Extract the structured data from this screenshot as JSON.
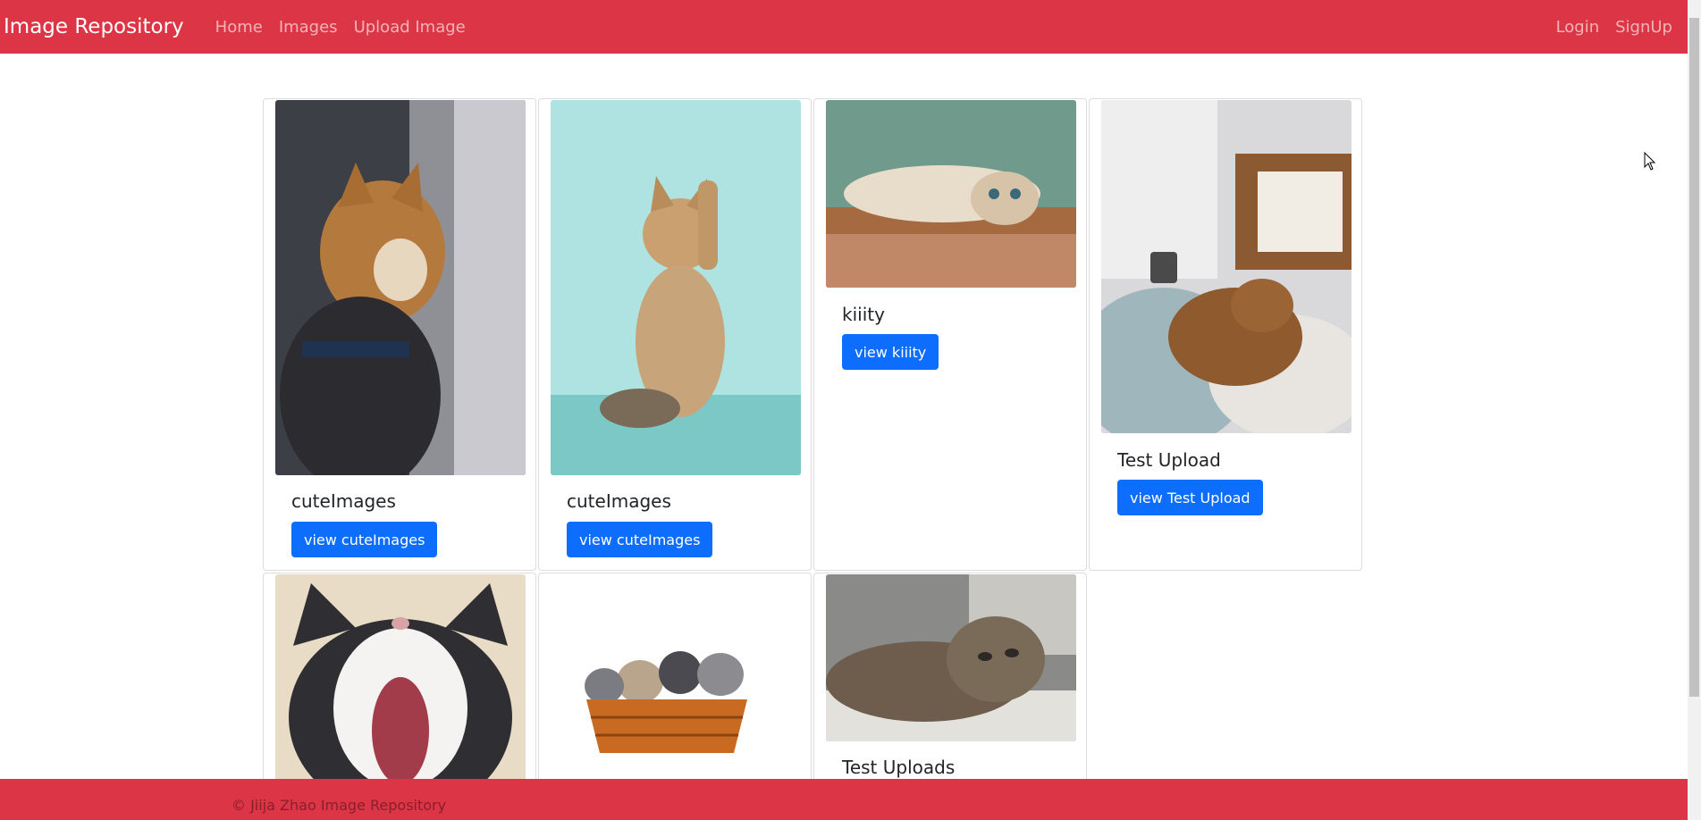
{
  "navbar": {
    "brand": "Image Repository",
    "links": [
      "Home",
      "Images",
      "Upload Image"
    ],
    "right_links": [
      "Login",
      "SignUp"
    ],
    "color": "#dc3545"
  },
  "cards": [
    {
      "title": "cuteImages",
      "button": "view cuteImages",
      "image": "cat-looking-out-window-image"
    },
    {
      "title": "cuteImages",
      "button": "view cuteImages",
      "image": "kitten-raising-paw-image"
    },
    {
      "title": "kiiity",
      "button": "view kiiity",
      "image": "cat-lying-on-floor-image"
    },
    {
      "title": "Test Upload",
      "button": "view Test Upload",
      "image": "cat-sleeping-on-bed-image"
    },
    {
      "title": "",
      "button": "",
      "image": "cat-yawning-image"
    },
    {
      "title": "",
      "button": "",
      "image": "kittens-in-basket-image"
    },
    {
      "title": "Test Uploads",
      "button": "",
      "image": "cat-lying-on-side-image"
    }
  ],
  "footer": {
    "text": "© Jiija Zhao Image Repository"
  },
  "colors": {
    "accent": "#dc3545",
    "button": "#0d6efd"
  }
}
